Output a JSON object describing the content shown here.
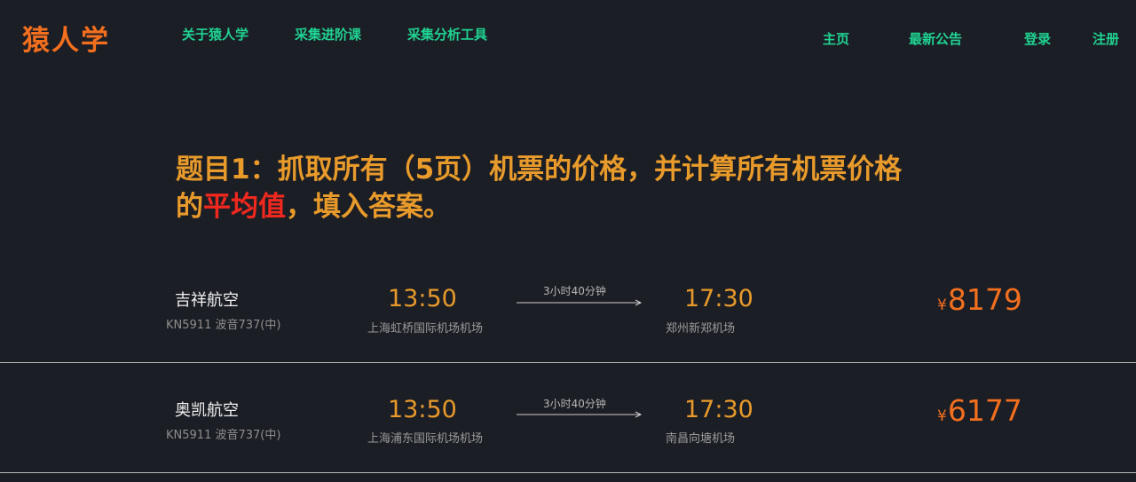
{
  "header": {
    "logo": "猿人学",
    "left_nav": [
      "关于猿人学",
      "采集进阶课",
      "采集分析工具"
    ],
    "right_nav": [
      "主页",
      "最新公告",
      "登录",
      "注册"
    ]
  },
  "question": {
    "text_before": "题目1：抓取所有（5页）机票的价格，并计算所有机票价格的",
    "highlight": "平均值",
    "text_after": "，填入答案。"
  },
  "flights": [
    {
      "airline": "吉祥航空",
      "flight_no": "KN5911 波音737(中)",
      "dep_time": "13:50",
      "dep_airport": "上海虹桥国际机场机场",
      "duration": "3小时40分钟",
      "arr_time": "17:30",
      "arr_airport": "郑州新郑机场",
      "currency": "¥",
      "price": "8179"
    },
    {
      "airline": "奥凯航空",
      "flight_no": "KN5911 波音737(中)",
      "dep_time": "13:50",
      "dep_airport": "上海浦东国际机场机场",
      "duration": "3小时40分钟",
      "arr_time": "17:30",
      "arr_airport": "南昌向塘机场",
      "currency": "¥",
      "price": "6177"
    }
  ],
  "colors": {
    "background": "#1c1e25",
    "nav": "#1fd392",
    "logo": "#f36f1e",
    "question": "#e89a2a",
    "highlight": "#f0281d",
    "price": "#f36f1e"
  }
}
